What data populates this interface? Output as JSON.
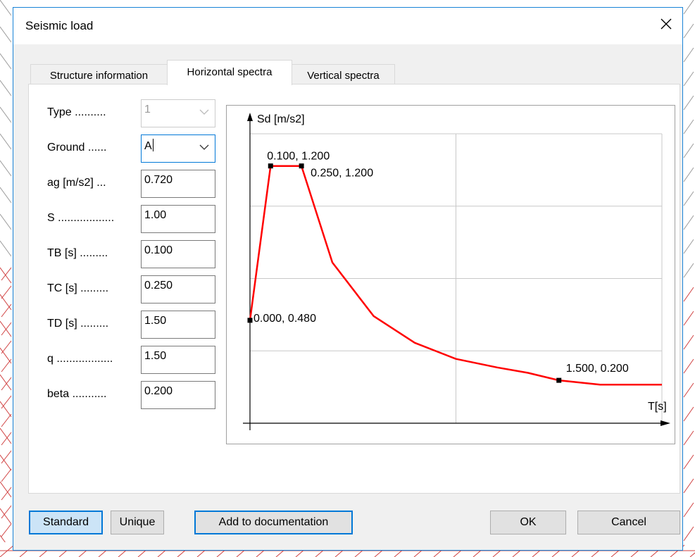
{
  "window": {
    "title": "Seismic load",
    "close_symbol": "✕"
  },
  "tabs": [
    {
      "label": "Structure information",
      "active": false
    },
    {
      "label": "Horizontal spectra",
      "active": true
    },
    {
      "label": "Vertical spectra",
      "active": false
    }
  ],
  "form": {
    "type": {
      "label": "Type ..........",
      "value": "1",
      "disabled": true,
      "icon": "chevron-down-icon"
    },
    "ground": {
      "label": "Ground ......",
      "value": "A",
      "icon": "chevron-down-icon"
    },
    "ag": {
      "label": "ag [m/s2] ...",
      "value": "0.720"
    },
    "s": {
      "label": "S ..................",
      "value": "1.00"
    },
    "tb": {
      "label": "TB [s] .........",
      "value": "0.100"
    },
    "tc": {
      "label": "TC [s] .........",
      "value": "0.250"
    },
    "td": {
      "label": "TD [s] .........",
      "value": "1.50"
    },
    "q": {
      "label": "q ..................",
      "value": "1.50"
    },
    "beta": {
      "label": "beta ...........",
      "value": "0.200"
    }
  },
  "chart_data": {
    "type": "line",
    "ylabel": "Sd [m/s2]",
    "xlabel": "T[s]",
    "grid": true,
    "series": [
      {
        "color": "#ff0000",
        "x": [
          0.0,
          0.1,
          0.25,
          0.4,
          0.6,
          0.8,
          1.0,
          1.2,
          1.35,
          1.5,
          1.7,
          2.0
        ],
        "y": [
          0.48,
          1.2,
          1.2,
          0.75,
          0.5,
          0.375,
          0.3,
          0.26,
          0.235,
          0.2,
          0.18,
          0.18
        ]
      }
    ],
    "markers": [
      {
        "x": 0.0,
        "y": 0.48,
        "label": "0.000, 0.480"
      },
      {
        "x": 0.1,
        "y": 1.2,
        "label": "0.100, 1.200"
      },
      {
        "x": 0.25,
        "y": 1.2,
        "label": "0.250, 1.200"
      },
      {
        "x": 1.5,
        "y": 0.2,
        "label": "1.500, 0.200"
      }
    ]
  },
  "buttons": {
    "standard": "Standard",
    "unique": "Unique",
    "add_doc": "Add to documentation",
    "ok": "OK",
    "cancel": "Cancel"
  },
  "colors": {
    "accent": "#0078d7",
    "curve": "#ff0000",
    "background_drawing": "#d04040"
  }
}
